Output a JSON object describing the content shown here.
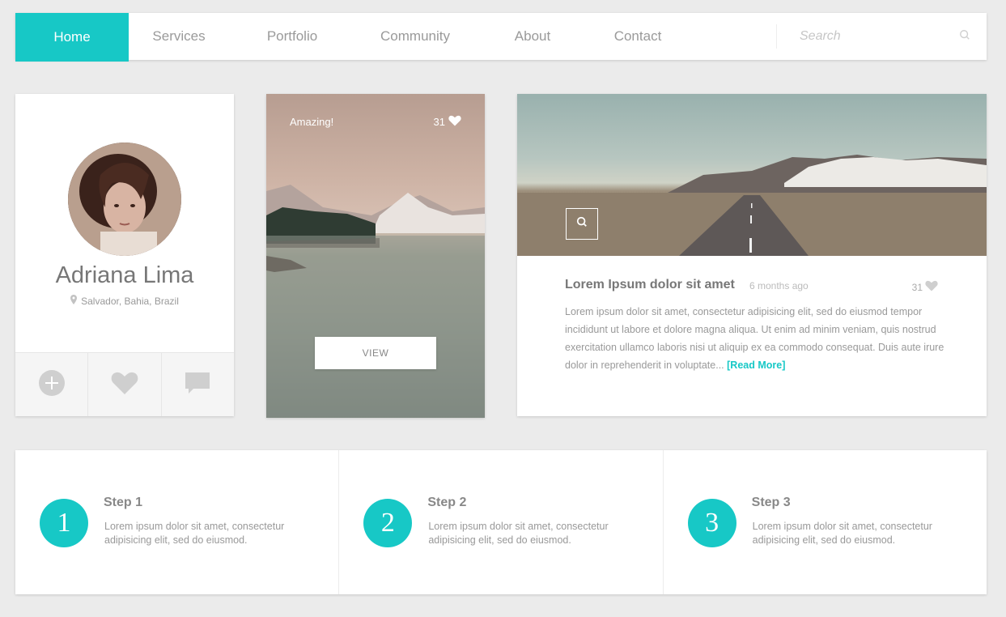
{
  "nav": {
    "items": [
      {
        "label": "Home"
      },
      {
        "label": "Services"
      },
      {
        "label": "Portfolio"
      },
      {
        "label": "Community"
      },
      {
        "label": "About"
      },
      {
        "label": "Contact"
      }
    ],
    "search_placeholder": "Search",
    "search_icon": "search-icon"
  },
  "profile": {
    "name": "Adriana Lima",
    "location": "Salvador, Bahia, Brazil",
    "location_icon": "map-pin-icon",
    "actions": [
      "add-icon",
      "heart-icon",
      "comment-icon"
    ]
  },
  "lake_card": {
    "caption": "Amazing!",
    "likes": "31",
    "button_label": "VIEW"
  },
  "article": {
    "title": "Lorem Ipsum dolor sit amet",
    "time": "6 months ago",
    "likes": "31",
    "body": "Lorem ipsum dolor sit amet, consectetur adipisicing elit, sed do eiusmod tempor incididunt ut labore et dolore magna aliqua. Ut enim ad minim veniam, quis nostrud exercitation ullamco laboris nisi ut aliquip ex ea commodo consequat. Duis aute irure dolor in reprehenderit in voluptate...",
    "read_more": "[Read More]"
  },
  "steps": [
    {
      "number": "1",
      "title": "Step 1",
      "text": "Lorem ipsum dolor sit amet, consectetur adipisicing elit, sed do eiusmod."
    },
    {
      "number": "2",
      "title": "Step 2",
      "text": "Lorem ipsum dolor sit amet, consectetur adipisicing elit, sed do eiusmod."
    },
    {
      "number": "3",
      "title": "Step 3",
      "text": "Lorem ipsum dolor sit amet, consectetur adipisicing elit, sed do eiusmod."
    }
  ],
  "colors": {
    "accent": "#17c8c6",
    "background": "#ebebeb",
    "card": "#ffffff"
  }
}
